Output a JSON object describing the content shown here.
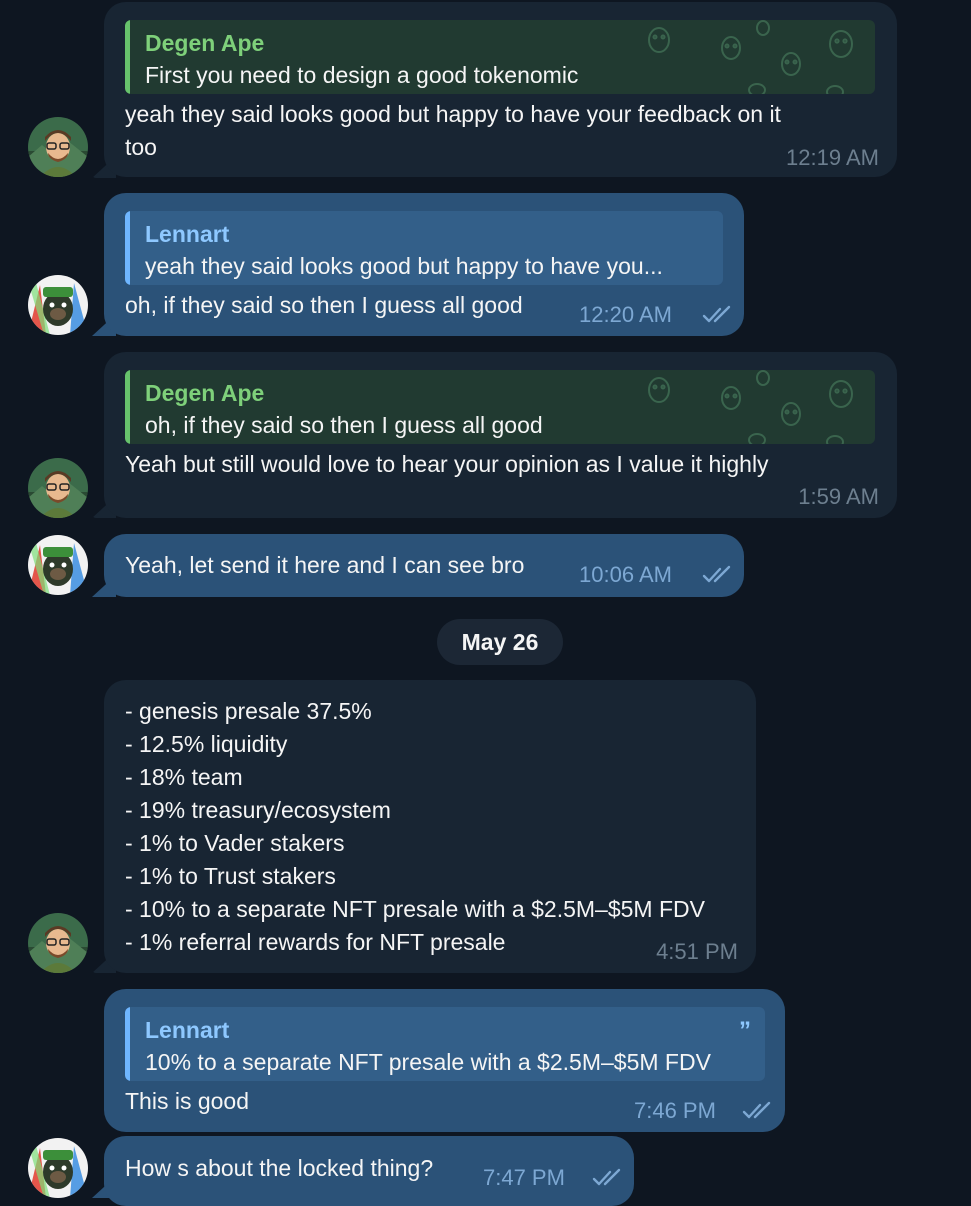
{
  "messages": [
    {
      "quote_name": "Degen Ape",
      "quote_text": "First you need to design a good tokenomic",
      "text_line1": "yeah they said looks good but happy to have your feedback on it",
      "text_line2": "too",
      "time": "12:19 AM"
    },
    {
      "quote_name": "Lennart",
      "quote_text": "yeah they said looks good but happy to have you...",
      "text": "oh, if they said so then I guess all good",
      "time": "12:20 AM"
    },
    {
      "quote_name": "Degen Ape",
      "quote_text": "oh, if they said so then I guess all good",
      "text": "Yeah but still would love to hear your opinion as I value it highly",
      "time": "1:59 AM"
    },
    {
      "text": "Yeah, let send it here and I can see bro",
      "time": "10:06 AM"
    },
    {
      "lines": [
        "- genesis presale 37.5%",
        "- 12.5% liquidity",
        "- 18% team",
        "- 19% treasury/ecosystem",
        "- 1% to Vader stakers",
        "- 1% to Trust stakers",
        "- 10% to a separate NFT presale with a $2.5M–$5M FDV",
        "- 1% referral rewards for NFT presale"
      ],
      "time": "4:51 PM"
    },
    {
      "quote_name": "Lennart",
      "quote_text": "10% to a separate NFT presale with a $2.5M–$5M FDV",
      "text": "This is good",
      "time": "7:46 PM"
    },
    {
      "text": "How s about the locked thing?",
      "time": "7:47 PM"
    }
  ],
  "date_separator": "May 26",
  "colors": {
    "background": "#0e1621",
    "incoming_bubble": "#182533",
    "outgoing_bubble": "#2b5278",
    "incoming_quote_accent": "#67c26c",
    "outgoing_quote_accent": "#6fb6ff"
  },
  "icons": {
    "read_receipt": "double-check-icon",
    "quote": "quote-icon"
  }
}
